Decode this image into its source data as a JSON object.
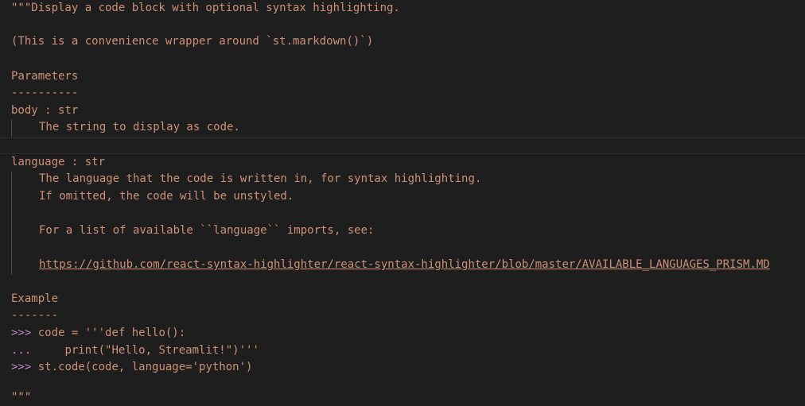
{
  "docstring": {
    "open_quote_line": "\"\"\"Display a code block with optional syntax highlighting.",
    "wrapper_note": "(This is a convenience wrapper around `st.markdown()`)",
    "params_heading": "Parameters",
    "params_underline": "----------",
    "param_body_sig": "body : str",
    "param_body_desc": "The string to display as code.",
    "param_language_sig": "language : str",
    "param_language_desc_1": "The language that the code is written in, for syntax highlighting.",
    "param_language_desc_2": "If omitted, the code will be unstyled.",
    "param_language_desc_3": "For a list of available ``language`` imports, see:",
    "param_language_url": "https://github.com/react-syntax-highlighter/react-syntax-highlighter/blob/master/AVAILABLE_LANGUAGES_PRISM.MD",
    "example_heading": "Example",
    "example_underline": "-------",
    "example_prompt_1": ">>>",
    "example_code_1": " code = '''def hello():",
    "example_cont_2": "...",
    "example_code_2": "     print(\"Hello, Streamlit!\")'''",
    "example_prompt_3": ">>>",
    "example_code_3": " st.code(code, language='python')",
    "close_quote": "\"\"\""
  },
  "colors": {
    "background": "#1e1e1e",
    "string": "#ce9178",
    "prompt": "#c586c0"
  }
}
